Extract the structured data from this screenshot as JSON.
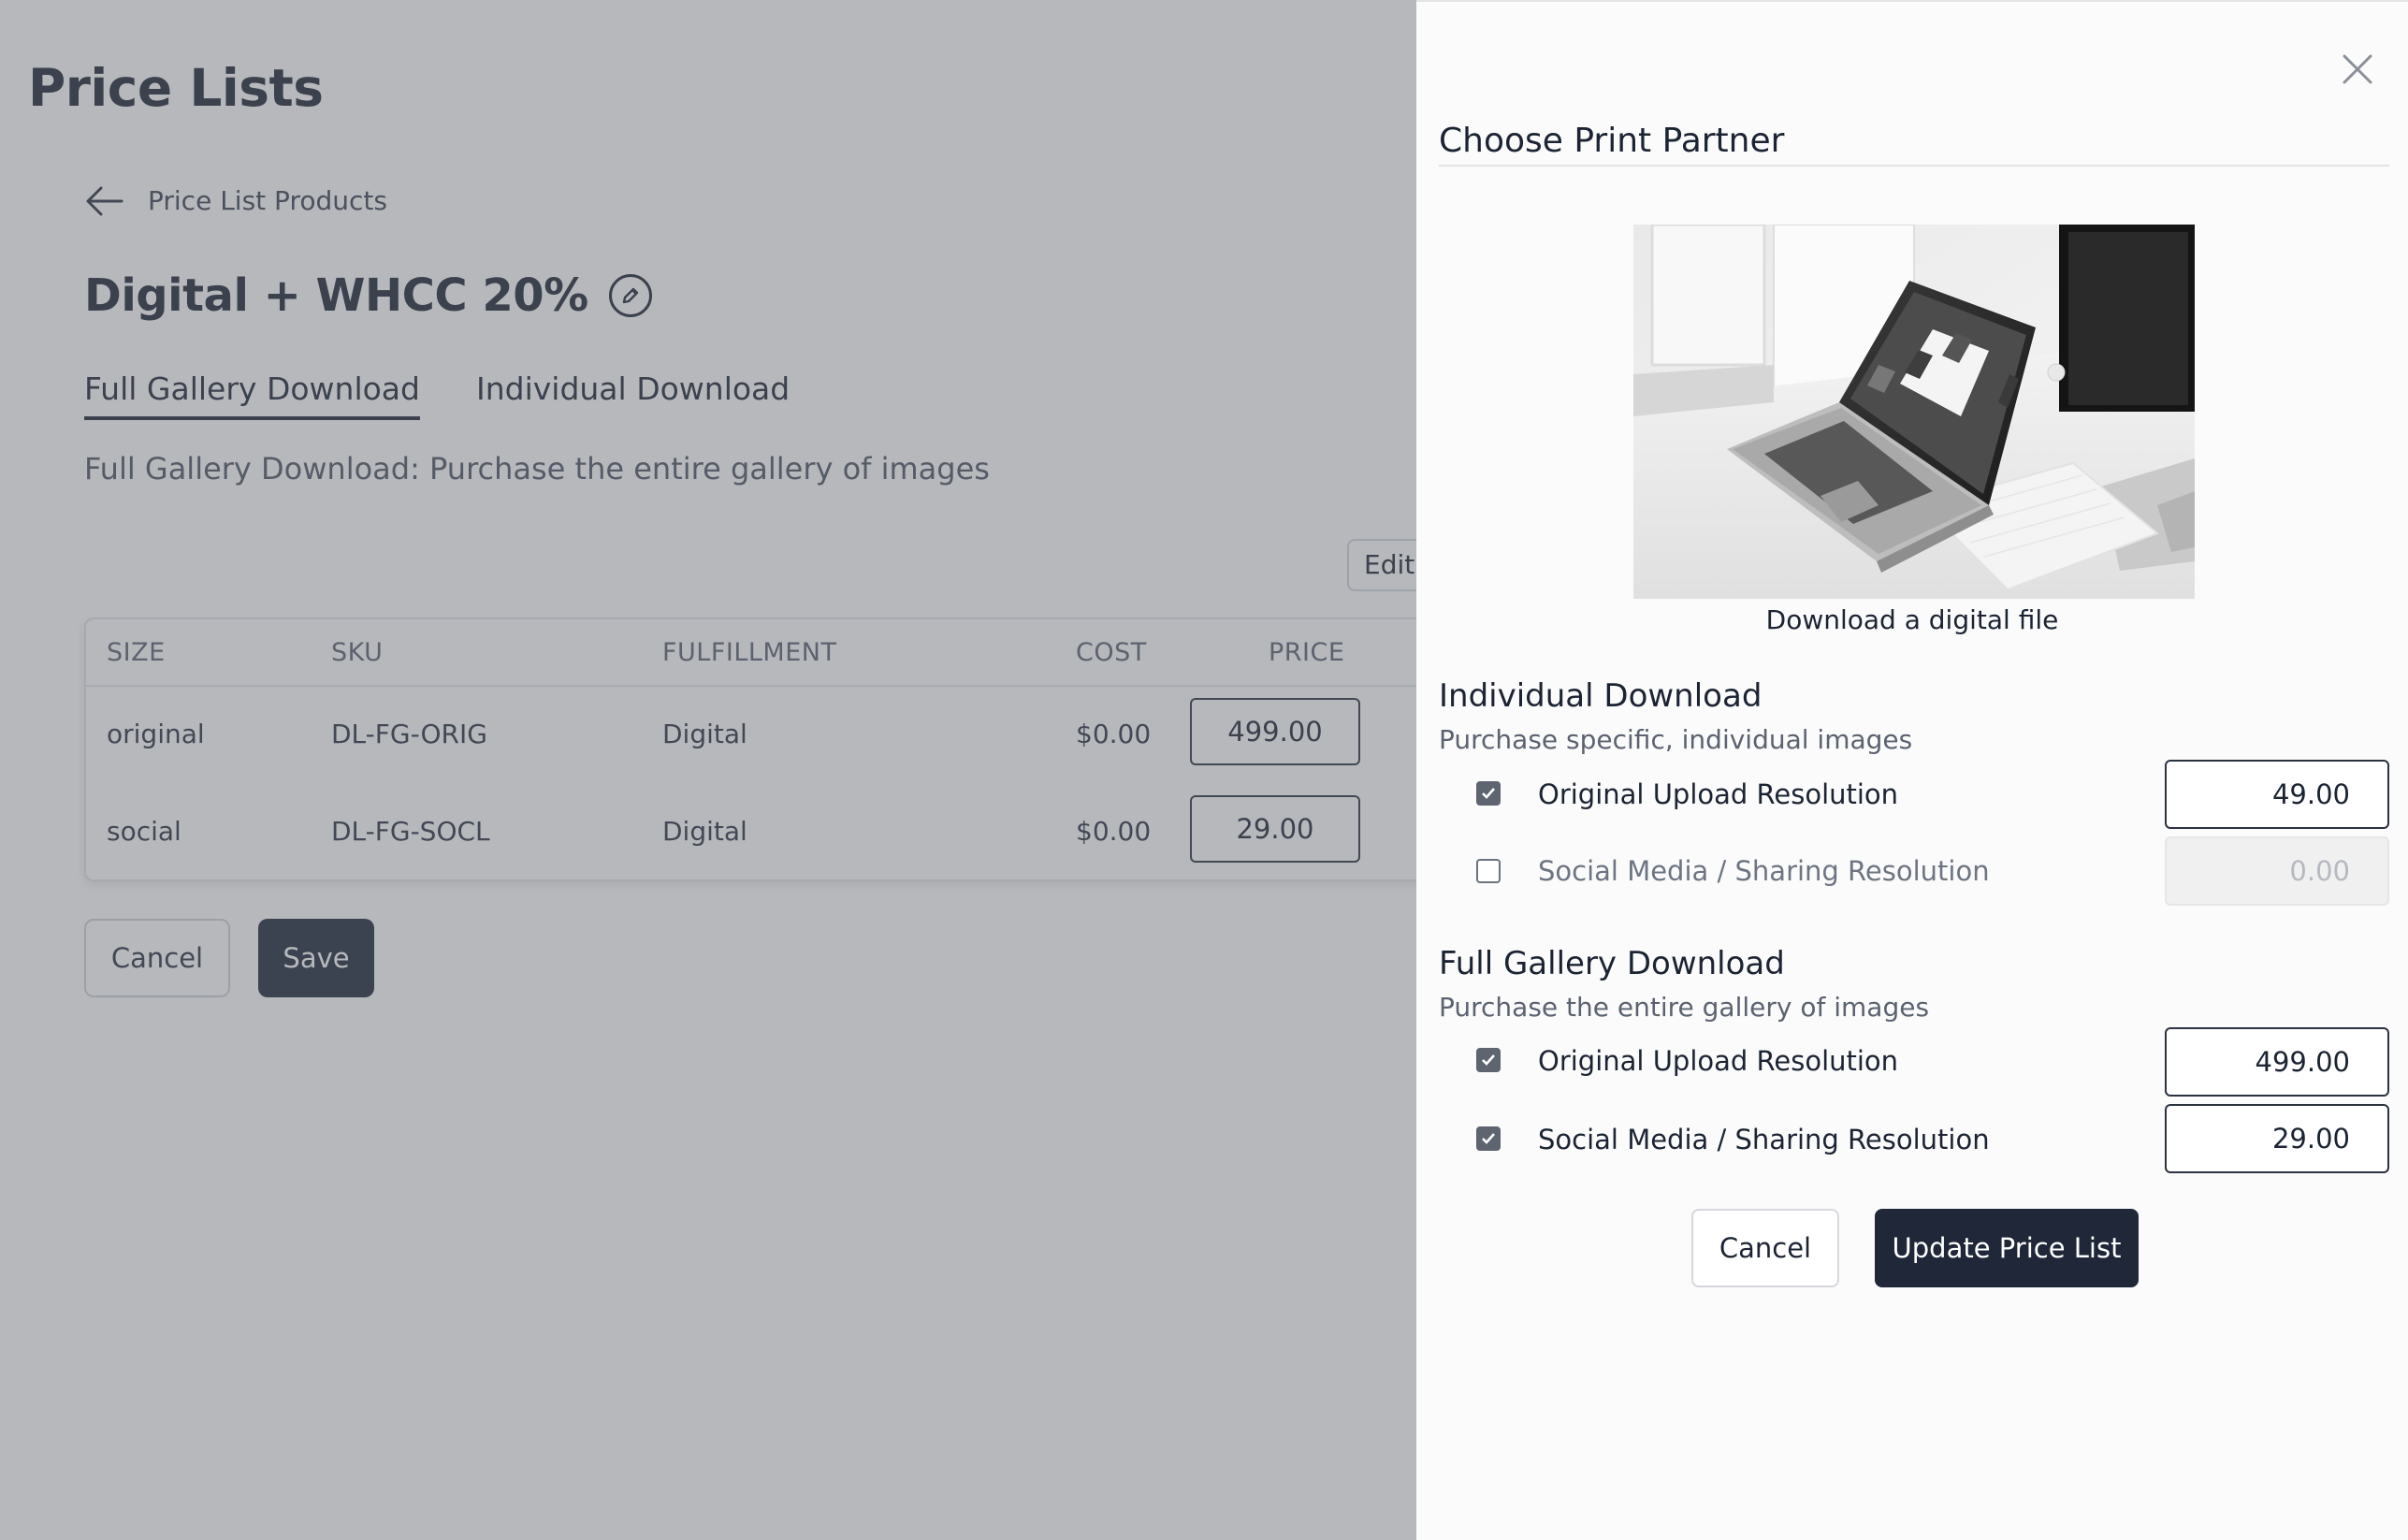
{
  "page": {
    "title": "Price Lists"
  },
  "back_link": {
    "label": "Price List Products"
  },
  "price_list": {
    "name": "Digital + WHCC 20%"
  },
  "tabs": [
    {
      "label": "Full Gallery Download",
      "active": true
    },
    {
      "label": "Individual Download",
      "active": false
    }
  ],
  "tab_description": "Full Gallery Download: Purchase the entire gallery of images",
  "edit_button": "Edit",
  "table": {
    "headers": [
      "SIZE",
      "SKU",
      "FULFILLMENT",
      "COST",
      "PRICE"
    ],
    "rows": [
      {
        "size": "original",
        "sku": "DL-FG-ORIG",
        "fulfillment": "Digital",
        "cost": "$0.00",
        "price": "499.00"
      },
      {
        "size": "social",
        "sku": "DL-FG-SOCL",
        "fulfillment": "Digital",
        "cost": "$0.00",
        "price": "29.00"
      }
    ]
  },
  "left_actions": {
    "cancel": "Cancel",
    "save": "Save"
  },
  "panel": {
    "title": "Choose Print Partner",
    "image_caption": "Download a digital file",
    "sections": [
      {
        "title": "Individual Download",
        "subtitle": "Purchase specific, individual images",
        "options": [
          {
            "label": "Original Upload Resolution",
            "checked": true,
            "price": "49.00",
            "enabled": true
          },
          {
            "label": "Social Media / Sharing Resolution",
            "checked": false,
            "price": "0.00",
            "enabled": false
          }
        ]
      },
      {
        "title": "Full Gallery Download",
        "subtitle": "Purchase the entire gallery of images",
        "options": [
          {
            "label": "Original Upload Resolution",
            "checked": true,
            "price": "499.00",
            "enabled": true
          },
          {
            "label": "Social Media / Sharing Resolution",
            "checked": true,
            "price": "29.00",
            "enabled": true
          }
        ]
      }
    ],
    "cancel": "Cancel",
    "update": "Update Price List"
  },
  "colors": {
    "primary_dark": "#1f2738",
    "overlay": "#5f646e"
  }
}
